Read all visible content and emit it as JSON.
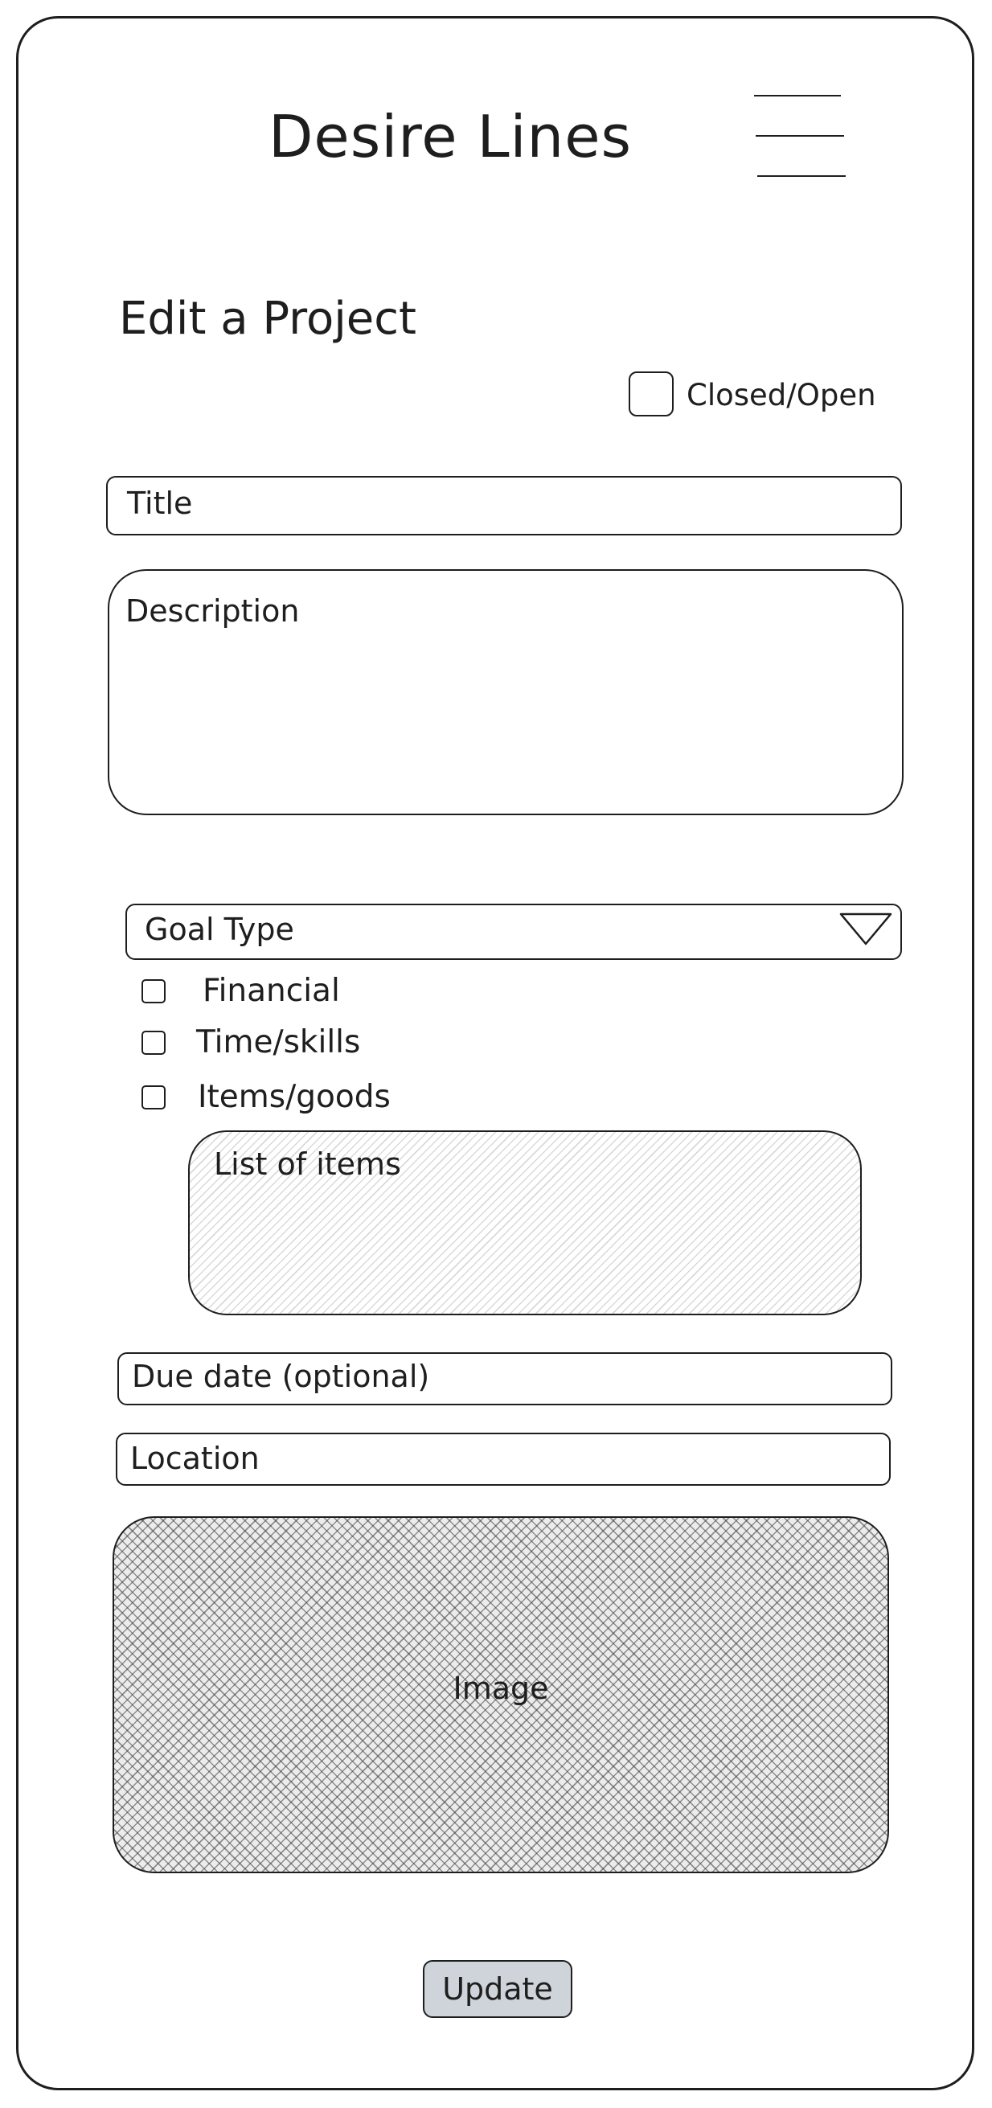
{
  "app": {
    "title": "Desire Lines"
  },
  "header": {
    "menu_icon": "hamburger-menu-icon"
  },
  "page": {
    "heading": "Edit a Project"
  },
  "status_toggle": {
    "label": "Closed/Open",
    "checked": false
  },
  "form": {
    "title_placeholder": "Title",
    "description_placeholder": "Description",
    "goal_type": {
      "selected": "Goal Type",
      "arrow_icon": "triangle-down-icon",
      "options": [
        {
          "label": "Financial",
          "checked": false
        },
        {
          "label": "Time/skills",
          "checked": false
        },
        {
          "label": "Items/goods",
          "checked": false
        }
      ]
    },
    "items_list_placeholder": "List of items",
    "due_date_placeholder": "Due date (optional)",
    "location_placeholder": "Location",
    "image_placeholder": "Image",
    "submit_label": "Update"
  },
  "colors": {
    "stroke": "#1e1e1e",
    "button_fill": "#ced4da",
    "hatch_light": "#d9d9d9",
    "hatch_dark": "#3c3c3c"
  }
}
